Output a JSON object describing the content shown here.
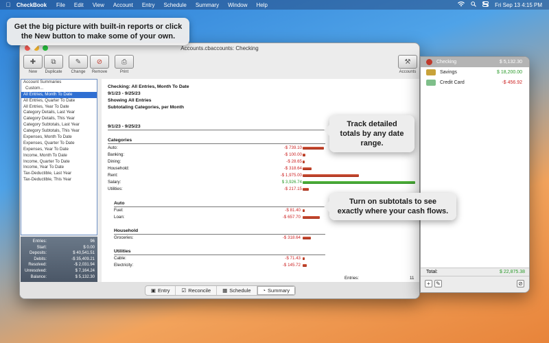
{
  "menubar": {
    "app": "CheckBook",
    "menus": [
      "File",
      "Edit",
      "View",
      "Account",
      "Entry",
      "Schedule",
      "Summary",
      "Window",
      "Help"
    ],
    "clock": "Fri Sep 13  4:15 PM"
  },
  "bubbles": {
    "top": "Get the big picture with built-in reports or click the New button to make some of your own.",
    "mid": "Track detailed totals by any date range.",
    "low": "Turn on subtotals to see exactly where your cash flows."
  },
  "window": {
    "title": "Accounts.cbaccounts:  Checking"
  },
  "toolbar": {
    "new": "New",
    "duplicate": "Duplicate",
    "change": "Change",
    "remove": "Remove",
    "print": "Print",
    "accounts": "Accounts"
  },
  "sidebar": {
    "items": [
      "Account Summaries",
      "Custom...",
      "All Entries, Month To Date",
      "All Entries, Quarter To Date",
      "All Entries, Year To Date",
      "Category Details, Last Year",
      "Category Details, This Year",
      "Category Subtotals, Last Year",
      "Category Subtotals, This Year",
      "Expenses, Month To Date",
      "Expenses, Quarter To Date",
      "Expenses, Year To Date",
      "Income, Month To Date",
      "Income, Quarter To Date",
      "Income, Year To Date",
      "Tax-Deductible, Last Year",
      "Tax-Deductible, This Year"
    ],
    "selected_index": 2
  },
  "stats": [
    {
      "label": "Entries:",
      "value": "96"
    },
    {
      "label": "Start:",
      "value": "$ 0.00"
    },
    {
      "label": "Deposits:",
      "value": "$ 40,541.51"
    },
    {
      "label": "Debits:",
      "value": "-$ 35,409.21"
    },
    {
      "label": "Resolved:",
      "value": "-$ 2,031.94"
    },
    {
      "label": "Unresolved:",
      "value": "$ 7,164.24"
    },
    {
      "label": "Balance:",
      "value": "$ 5,132.30"
    }
  ],
  "report": {
    "title": "Checking:  All Entries, Month To Date",
    "range": "9/1/23 - 9/25/23",
    "showing": "Showing All Entries",
    "subtotaling": "Subtotaling Categories, per Month",
    "period": "9/1/23 - 9/25/23",
    "categories_label": "Categories",
    "categories": [
      {
        "name": "Auto:",
        "amount": "-$ 739.10",
        "value": -739.1
      },
      {
        "name": "Banking:",
        "amount": "-$ 100.00",
        "value": -100.0
      },
      {
        "name": "Dining:",
        "amount": "-$ 28.65",
        "value": -28.65
      },
      {
        "name": "Household:",
        "amount": "-$ 318.64",
        "value": -318.64
      },
      {
        "name": "Rent:",
        "amount": "-$ 1,975.00",
        "value": -1975.0
      },
      {
        "name": "Salary:",
        "amount": "$ 3,926.74",
        "value": 3926.74
      },
      {
        "name": "Utilities:",
        "amount": "-$ 217.15",
        "value": -217.15
      }
    ],
    "subgroups": [
      {
        "title": "Auto",
        "rows": [
          {
            "name": "Fuel:",
            "amount": "-$ 81.40",
            "value": -81.4
          },
          {
            "name": "Loan:",
            "amount": "-$ 657.70",
            "value": -657.7
          }
        ]
      },
      {
        "title": "Household",
        "rows": [
          {
            "name": "Groceries:",
            "amount": "-$ 318.64",
            "value": -318.64
          }
        ]
      },
      {
        "title": "Utilities",
        "rows": [
          {
            "name": "Cable:",
            "amount": "-$ 71.43",
            "value": -71.43
          },
          {
            "name": "Electricity:",
            "amount": "-$ 145.72",
            "value": -145.72
          }
        ]
      }
    ],
    "entries_label": "Entries:",
    "entries_count": "11"
  },
  "tabs": [
    {
      "label": "Entry",
      "icon": "entry-icon"
    },
    {
      "label": "Reconcile",
      "icon": "checkbox-icon"
    },
    {
      "label": "Schedule",
      "icon": "calendar-icon"
    },
    {
      "label": "Summary",
      "icon": "pie-chart-icon"
    }
  ],
  "active_tab": 3,
  "accounts": [
    {
      "name": "Checking",
      "balance": "$ 5,132.30",
      "color": "#9aa4b0"
    },
    {
      "name": "Savings",
      "balance": "$ 18,200.00",
      "color": "#c8a23a"
    },
    {
      "name": "Credit Card",
      "balance": "-$ 456.92",
      "color": "#7fbf8a"
    }
  ],
  "accounts_total": {
    "label": "Total:",
    "value": "$ 22,875.38"
  },
  "colors": {
    "negative": "#cc2222",
    "positive": "#2a9a2a",
    "selection": "#2f6fd2"
  }
}
